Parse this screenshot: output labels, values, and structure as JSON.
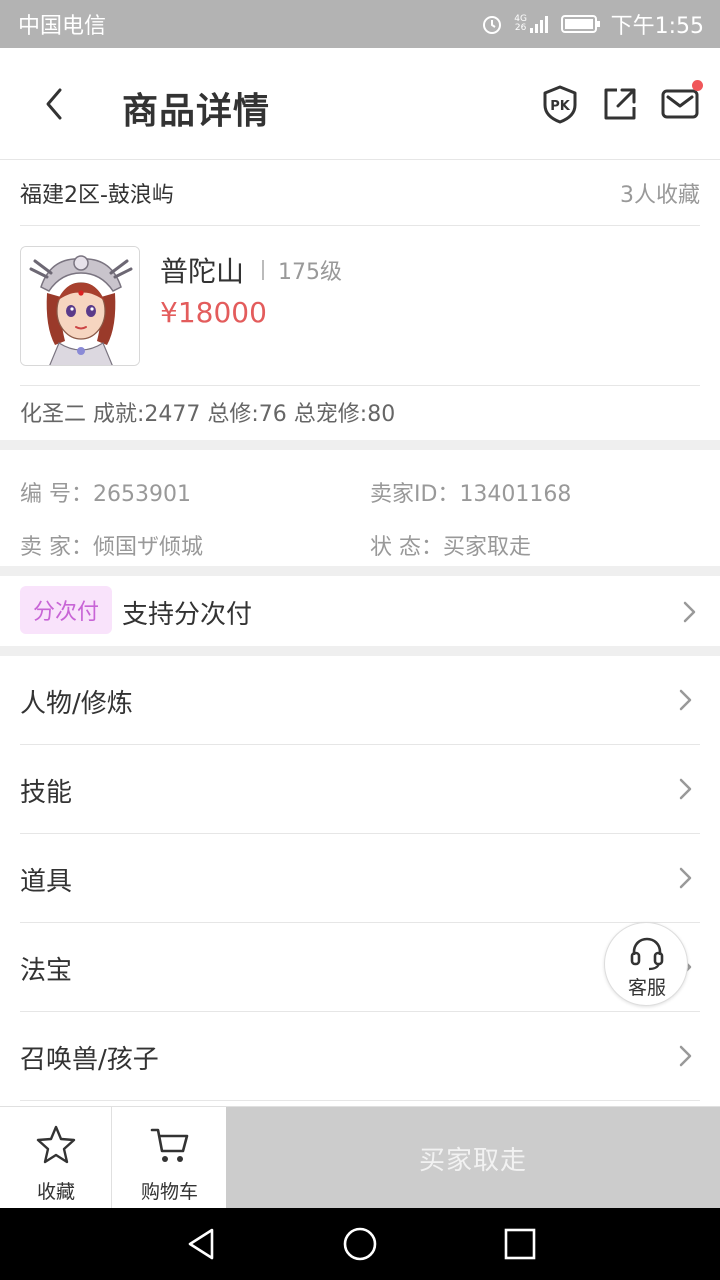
{
  "status_bar": {
    "carrier": "中国电信",
    "network": "4G 26",
    "time": "下午1:55"
  },
  "header": {
    "title": "商品详情",
    "icons": [
      "back-icon",
      "pk-icon",
      "share-icon",
      "mail-icon"
    ]
  },
  "server": {
    "name": "福建2区-鼓浪屿",
    "favorites": "3人收藏"
  },
  "character": {
    "school": "普陀山",
    "level": "175级",
    "price": "¥18000",
    "stats": "化圣二 成就:2477 总修:76 总宠修:80"
  },
  "info": {
    "id_label": "编  号：",
    "id_value": "2653901",
    "seller_id_label": "卖家ID：",
    "seller_id_value": "13401168",
    "seller_label": "卖  家：",
    "seller_value": "倾国ザ倾城",
    "status_label": "状  态：",
    "status_value": "买家取走"
  },
  "installment": {
    "badge": "分次付",
    "text": "支持分次付"
  },
  "sections": [
    {
      "label": "人物/修炼"
    },
    {
      "label": "技能"
    },
    {
      "label": "道具"
    },
    {
      "label": "法宝"
    },
    {
      "label": "召唤兽/孩子"
    }
  ],
  "customer_service": {
    "label": "客服"
  },
  "action_bar": {
    "favorite_label": "收藏",
    "cart_label": "购物车",
    "buy_label": "买家取走"
  },
  "colors": {
    "price": "#e35c5c",
    "badge_bg": "#f9e3fb",
    "badge_text": "#c865d6",
    "notification_dot": "#f0575a",
    "disabled_button": "#cccccc"
  }
}
